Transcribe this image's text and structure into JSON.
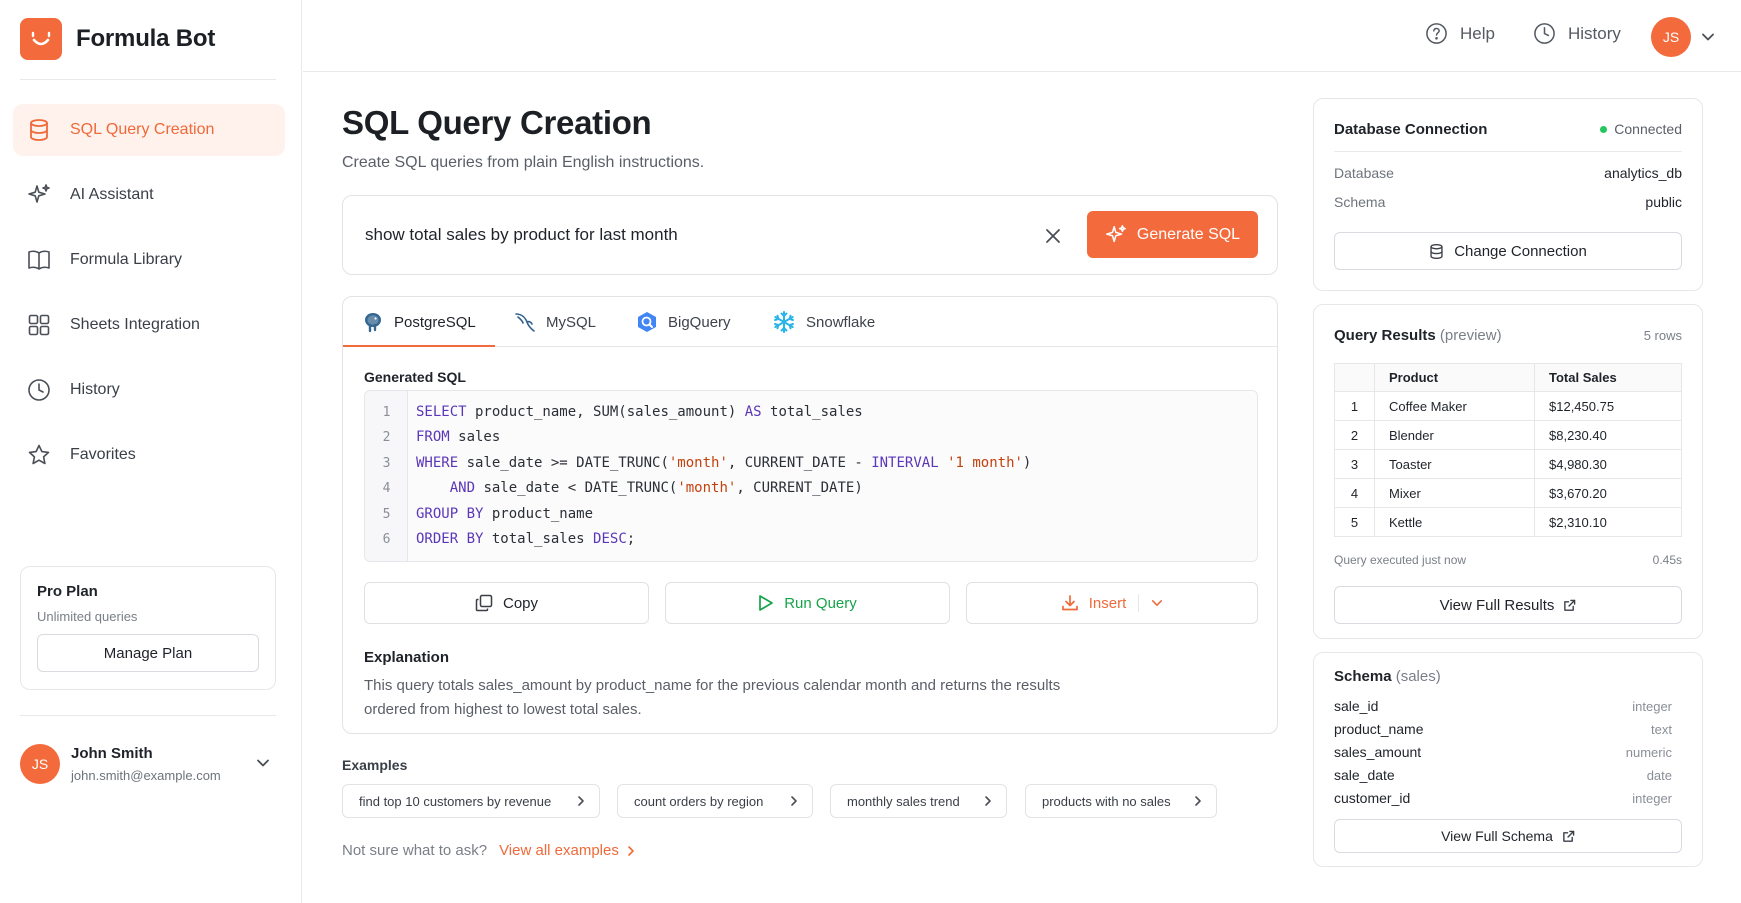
{
  "brand": {
    "name": "Formula Bot",
    "logo_icon": "smile-logo-icon",
    "accent": "#f36a3c"
  },
  "sidebar": {
    "items": [
      {
        "label": "SQL Query Creation",
        "icon": "database-icon",
        "active": true
      },
      {
        "label": "AI Assistant",
        "icon": "sparkle-icon",
        "active": false
      },
      {
        "label": "Formula Library",
        "icon": "book-icon",
        "active": false
      },
      {
        "label": "Sheets Integration",
        "icon": "grid-icon",
        "active": false
      },
      {
        "label": "History",
        "icon": "clock-icon",
        "active": false
      },
      {
        "label": "Favorites",
        "icon": "star-icon",
        "active": false
      }
    ],
    "plan": {
      "title": "Pro Plan",
      "subtitle": "Unlimited queries",
      "button": "Manage Plan"
    },
    "user": {
      "initials": "JS",
      "name": "John Smith",
      "email": "john.smith@example.com"
    }
  },
  "topbar": {
    "help_label": "Help",
    "history_label": "History",
    "avatar_initials": "JS"
  },
  "main": {
    "title": "SQL Query Creation",
    "subtitle": "Create SQL queries from plain English instructions.",
    "prompt": {
      "value": "show total sales by product for last month",
      "generate_label": "Generate SQL"
    },
    "tabs": [
      {
        "label": "PostgreSQL",
        "icon": "postgresql-icon",
        "active": true
      },
      {
        "label": "MySQL",
        "icon": "mysql-icon",
        "active": false
      },
      {
        "label": "BigQuery",
        "icon": "bigquery-icon",
        "active": false
      },
      {
        "label": "Snowflake",
        "icon": "snowflake-icon",
        "active": false
      }
    ],
    "generated_label": "Generated SQL",
    "code": {
      "line_numbers": [
        "1",
        "2",
        "3",
        "4",
        "5",
        "6"
      ],
      "lines": [
        {
          "k1": "SELECT",
          "t1": " product_name, SUM(sales_amount) ",
          "k2": "AS",
          "t2": " total_sales"
        },
        {
          "k1": "FROM",
          "t1": " sales"
        },
        {
          "k1": "WHERE",
          "t1": " sale_date >= DATE_TRUNC(",
          "s1": "'month'",
          "t2": ", CURRENT_DATE - ",
          "k2": "INTERVAL",
          "t3": " ",
          "s2": "'1 month'",
          "t4": ")"
        },
        {
          "pad": "    ",
          "k1": "AND",
          "t1": " sale_date < DATE_TRUNC(",
          "s1": "'month'",
          "t2": ", CURRENT_DATE)"
        },
        {
          "k1": "GROUP",
          "t1": " ",
          "k2": "BY",
          "t2": " product_name"
        },
        {
          "k1": "ORDER",
          "t1": " ",
          "k2": "BY",
          "t2": " total_sales ",
          "k3": "DESC",
          "t3": ";"
        }
      ]
    },
    "actions": {
      "copy": "Copy",
      "run": "Run Query",
      "insert": "Insert"
    },
    "explanation_label": "Explanation",
    "explanation": "This query totals sales_amount by product_name for the previous calendar month and returns the results ordered from highest to lowest total sales.",
    "examples_label": "Examples",
    "examples": [
      "find top 10 customers by revenue",
      "count orders by region",
      "monthly sales trend",
      "products with no sales"
    ],
    "help_text": "Not sure what to ask?",
    "help_link": "View all examples"
  },
  "connection": {
    "title": "Database Connection",
    "status": "Connected",
    "status_color": "#22c55e",
    "database_label": "Database",
    "database_value": "analytics_db",
    "schema_label": "Schema",
    "schema_value": "public",
    "button": "Change Connection"
  },
  "results": {
    "title": "Query Results",
    "title_note": "(preview)",
    "rows_count": "5 rows",
    "columns": [
      "Product",
      "Total Sales"
    ],
    "rows": [
      {
        "idx": "1",
        "product": "Coffee Maker",
        "sales": "$12,450.75"
      },
      {
        "idx": "2",
        "product": "Blender",
        "sales": "$8,230.40"
      },
      {
        "idx": "3",
        "product": "Toaster",
        "sales": "$4,980.30"
      },
      {
        "idx": "4",
        "product": "Mixer",
        "sales": "$3,670.20"
      },
      {
        "idx": "5",
        "product": "Kettle",
        "sales": "$2,310.10"
      }
    ],
    "executed": "Query executed just now",
    "time": "0.45s",
    "button": "View Full Results"
  },
  "schema": {
    "title": "Schema",
    "title_note": "(sales)",
    "fields": [
      {
        "name": "sale_id",
        "type": "integer"
      },
      {
        "name": "product_name",
        "type": "text"
      },
      {
        "name": "sales_amount",
        "type": "numeric"
      },
      {
        "name": "sale_date",
        "type": "date"
      },
      {
        "name": "customer_id",
        "type": "integer"
      }
    ],
    "button": "View Full Schema"
  }
}
